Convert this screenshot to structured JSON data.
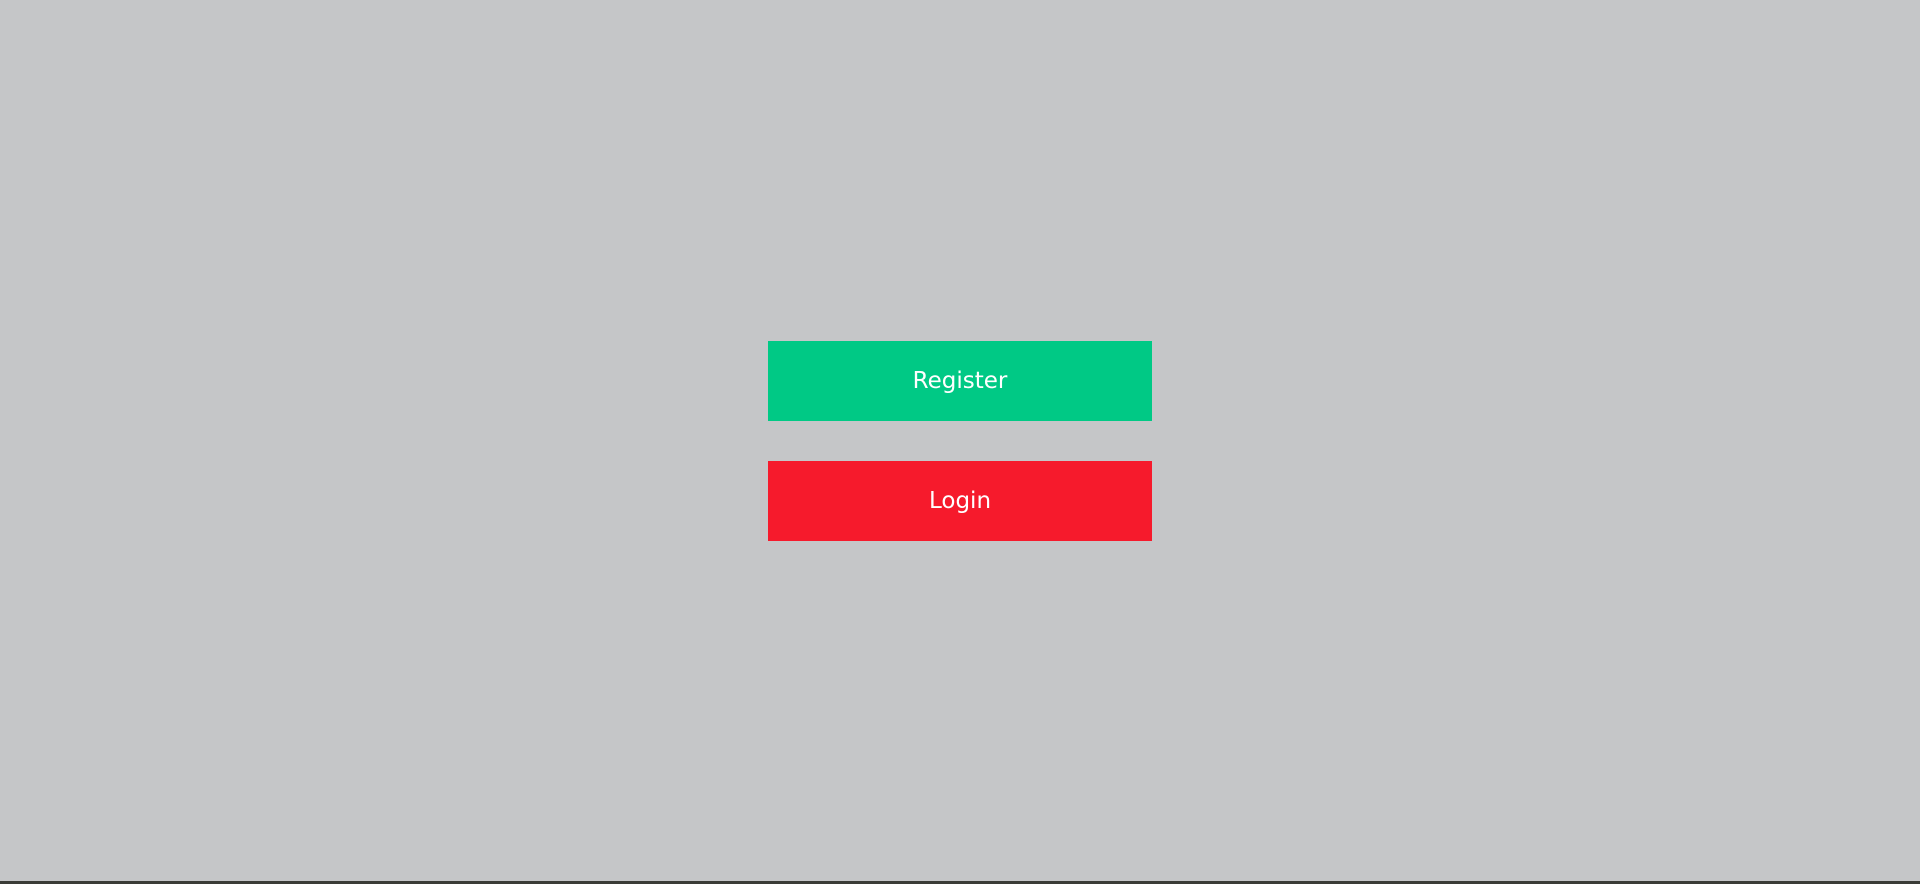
{
  "buttons": {
    "register": {
      "label": "Register",
      "color": "#00c985"
    },
    "login": {
      "label": "Login",
      "color": "#f61a2c"
    }
  },
  "colors": {
    "background": "#c5c6c8",
    "button_text": "#ffffff"
  }
}
